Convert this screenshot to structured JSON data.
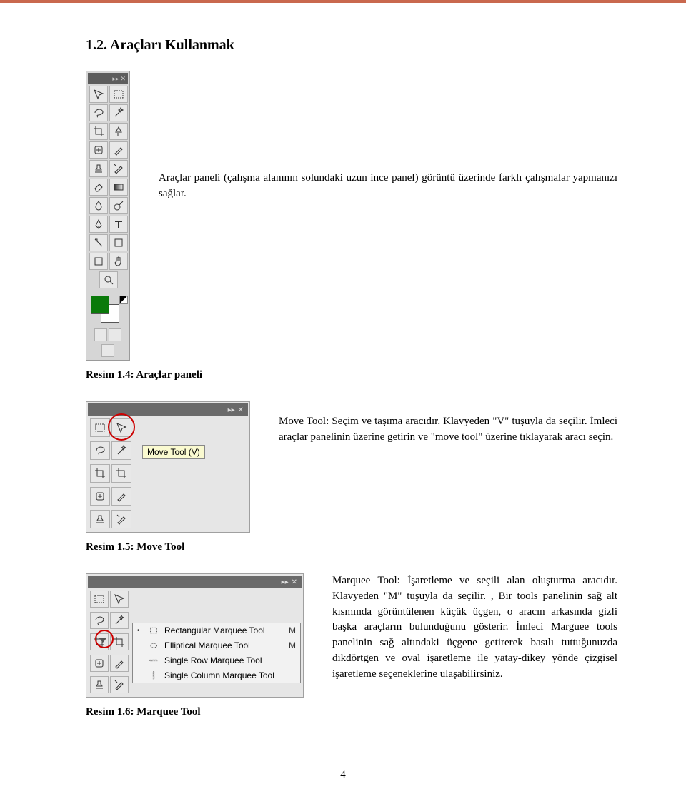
{
  "section_heading": "1.2. Araçları Kullanmak",
  "para_tools_panel": "Araçlar paneli (çalışma alanının solundaki uzun ince panel) görüntü üzerinde farklı çalışmalar yapmanızı sağlar.",
  "caption_tools_panel": "Resim 1.4: Araçlar paneli",
  "para_move_tool": "Move Tool:  Seçim ve taşıma aracıdır. Klavyeden \"V\" tuşuyla da seçilir. İmleci araçlar panelinin üzerine getirin ve \"move tool\" üzerine tıklayarak aracı seçin.",
  "caption_move_tool": "Resim 1.5: Move Tool",
  "para_marquee_tool": "Marquee Tool: İşaretleme ve seçili alan oluşturma aracıdır. Klavyeden \"M\" tuşuyla da seçilir. , Bir tools panelinin sağ alt kısmında görüntülenen küçük üçgen, o aracın arkasında gizli başka araçların bulunduğunu gösterir. İmleci Marguee tools panelinin sağ altındaki üçgene getirerek basılı tuttuğunuzda dikdörtgen ve oval işaretleme ile yatay-dikey yönde çizgisel işaretleme seçeneklerine ulaşabilirsiniz.",
  "caption_marquee_tool": "Resim 1.6: Marquee Tool",
  "page_number": "4",
  "move_tooltip": "Move Tool (V)",
  "flyout": {
    "items": [
      {
        "dot": "•",
        "label": "Rectangular Marquee Tool",
        "shortcut": "M"
      },
      {
        "dot": "",
        "label": "Elliptical Marquee Tool",
        "shortcut": "M"
      },
      {
        "dot": "",
        "label": "Single Row Marquee Tool",
        "shortcut": ""
      },
      {
        "dot": "",
        "label": "Single Column Marquee Tool",
        "shortcut": ""
      }
    ]
  },
  "icons": {
    "move": "move-icon",
    "marquee": "marquee-icon",
    "lasso": "lasso-icon",
    "wand": "wand-icon",
    "crop": "crop-icon",
    "eyedrop": "eyedropper-icon",
    "heal": "heal-icon",
    "brush": "brush-icon",
    "stamp": "stamp-icon",
    "history": "history-brush-icon",
    "eraser": "eraser-icon",
    "gradient": "gradient-icon",
    "blur": "blur-icon",
    "dodge": "dodge-icon",
    "pen": "pen-icon",
    "type": "type-icon",
    "path": "path-select-icon",
    "shape": "shape-icon",
    "notes": "notes-icon",
    "hand": "hand-icon",
    "zoom": "zoom-icon"
  }
}
